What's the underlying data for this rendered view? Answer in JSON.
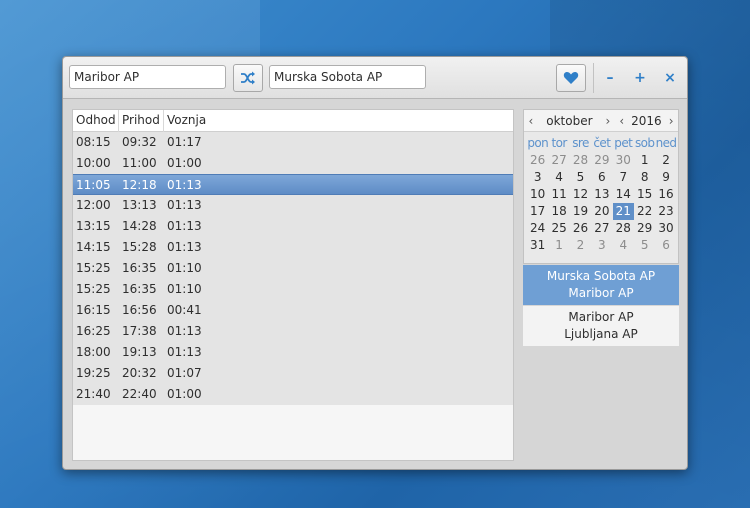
{
  "search": {
    "from_value": "Maribor AP",
    "to_value": "Murska Sobota AP"
  },
  "icons": {
    "swap": "shuffle-icon",
    "favorite": "heart-icon"
  },
  "window_controls": {
    "minimize": "–",
    "maximize": "+",
    "close": "×"
  },
  "colors": {
    "accent": "#2f7fc8",
    "selection": "#6f9fd4",
    "today": "#5f8fc8"
  },
  "table": {
    "headers": {
      "departure": "Odhod",
      "arrival": "Prihod",
      "duration": "Voznja"
    },
    "rows": [
      {
        "departure": "08:15",
        "arrival": "09:32",
        "duration": "01:17"
      },
      {
        "departure": "10:00",
        "arrival": "11:00",
        "duration": "01:00"
      },
      {
        "departure": "11:05",
        "arrival": "12:18",
        "duration": "01:13"
      },
      {
        "departure": "12:00",
        "arrival": "13:13",
        "duration": "01:13"
      },
      {
        "departure": "13:15",
        "arrival": "14:28",
        "duration": "01:13"
      },
      {
        "departure": "14:15",
        "arrival": "15:28",
        "duration": "01:13"
      },
      {
        "departure": "15:25",
        "arrival": "16:35",
        "duration": "01:10"
      },
      {
        "departure": "15:25",
        "arrival": "16:35",
        "duration": "01:10"
      },
      {
        "departure": "16:15",
        "arrival": "16:56",
        "duration": "00:41"
      },
      {
        "departure": "16:25",
        "arrival": "17:38",
        "duration": "01:13"
      },
      {
        "departure": "18:00",
        "arrival": "19:13",
        "duration": "01:13"
      },
      {
        "departure": "19:25",
        "arrival": "20:32",
        "duration": "01:07"
      },
      {
        "departure": "21:40",
        "arrival": "22:40",
        "duration": "01:00"
      }
    ]
  },
  "calendar": {
    "prev_month": "‹",
    "next_month": "›",
    "prev_year": "‹",
    "next_year": "›",
    "month": "oktober",
    "year": "2016",
    "day_names": [
      "pon",
      "tor",
      "sre",
      "čet",
      "pet",
      "sob",
      "ned"
    ],
    "weeks": [
      [
        "26",
        "27",
        "28",
        "29",
        "30",
        "1",
        "2"
      ],
      [
        "3",
        "4",
        "5",
        "6",
        "7",
        "8",
        "9"
      ],
      [
        "10",
        "11",
        "12",
        "13",
        "14",
        "15",
        "16"
      ],
      [
        "17",
        "18",
        "19",
        "20",
        "21",
        "22",
        "23"
      ],
      [
        "24",
        "25",
        "26",
        "27",
        "28",
        "29",
        "30"
      ],
      [
        "31",
        "1",
        "2",
        "3",
        "4",
        "5",
        "6"
      ]
    ]
  },
  "favorites": [
    {
      "from": "Murska Sobota AP",
      "to": "Maribor AP"
    },
    {
      "from": "Maribor AP",
      "to": "Ljubljana AP"
    }
  ]
}
